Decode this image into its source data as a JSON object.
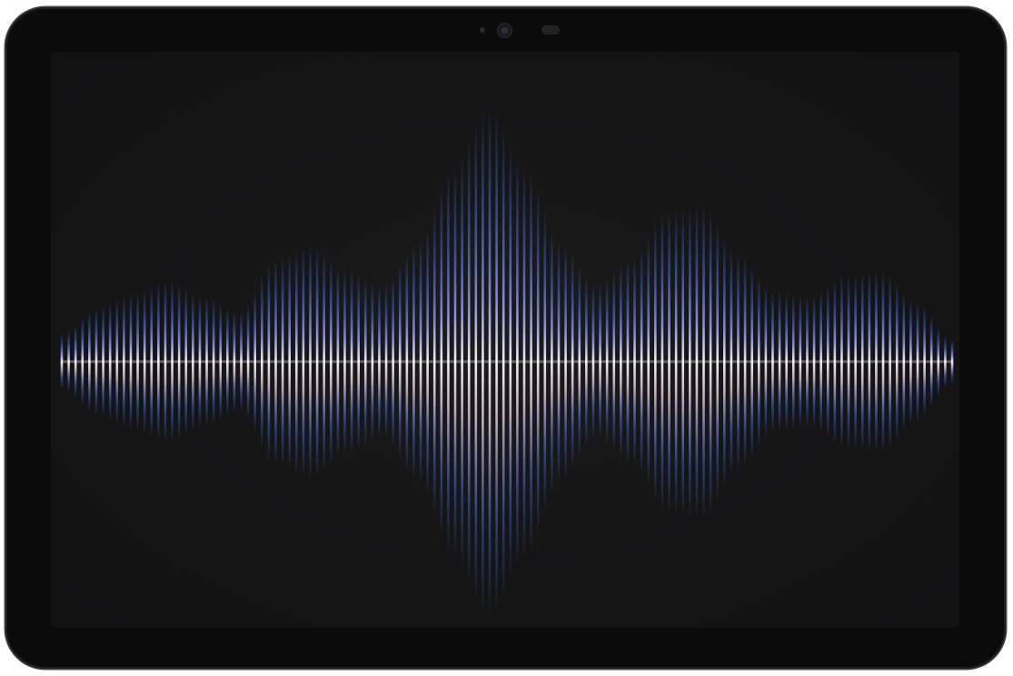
{
  "device": {
    "type": "tablet",
    "orientation": "landscape",
    "bezel_color": "#0b0b0c",
    "screen_background": "#151516"
  },
  "screen_content": {
    "visual": "audio-waveform",
    "bar_count": 130,
    "colors": {
      "tip": "#3b63c8",
      "mid": "#8d94e0",
      "center_line": "#f2ecf4",
      "lower_tint": "#c9b2c8"
    },
    "envelope_levels": [
      0.1,
      0.2,
      0.25,
      0.3,
      0.24,
      0.18,
      0.38,
      0.43,
      0.34,
      0.28,
      0.44,
      0.72,
      0.95,
      0.72,
      0.44,
      0.28,
      0.38,
      0.56,
      0.58,
      0.4,
      0.26,
      0.24,
      0.32,
      0.34,
      0.22,
      0.08
    ]
  }
}
